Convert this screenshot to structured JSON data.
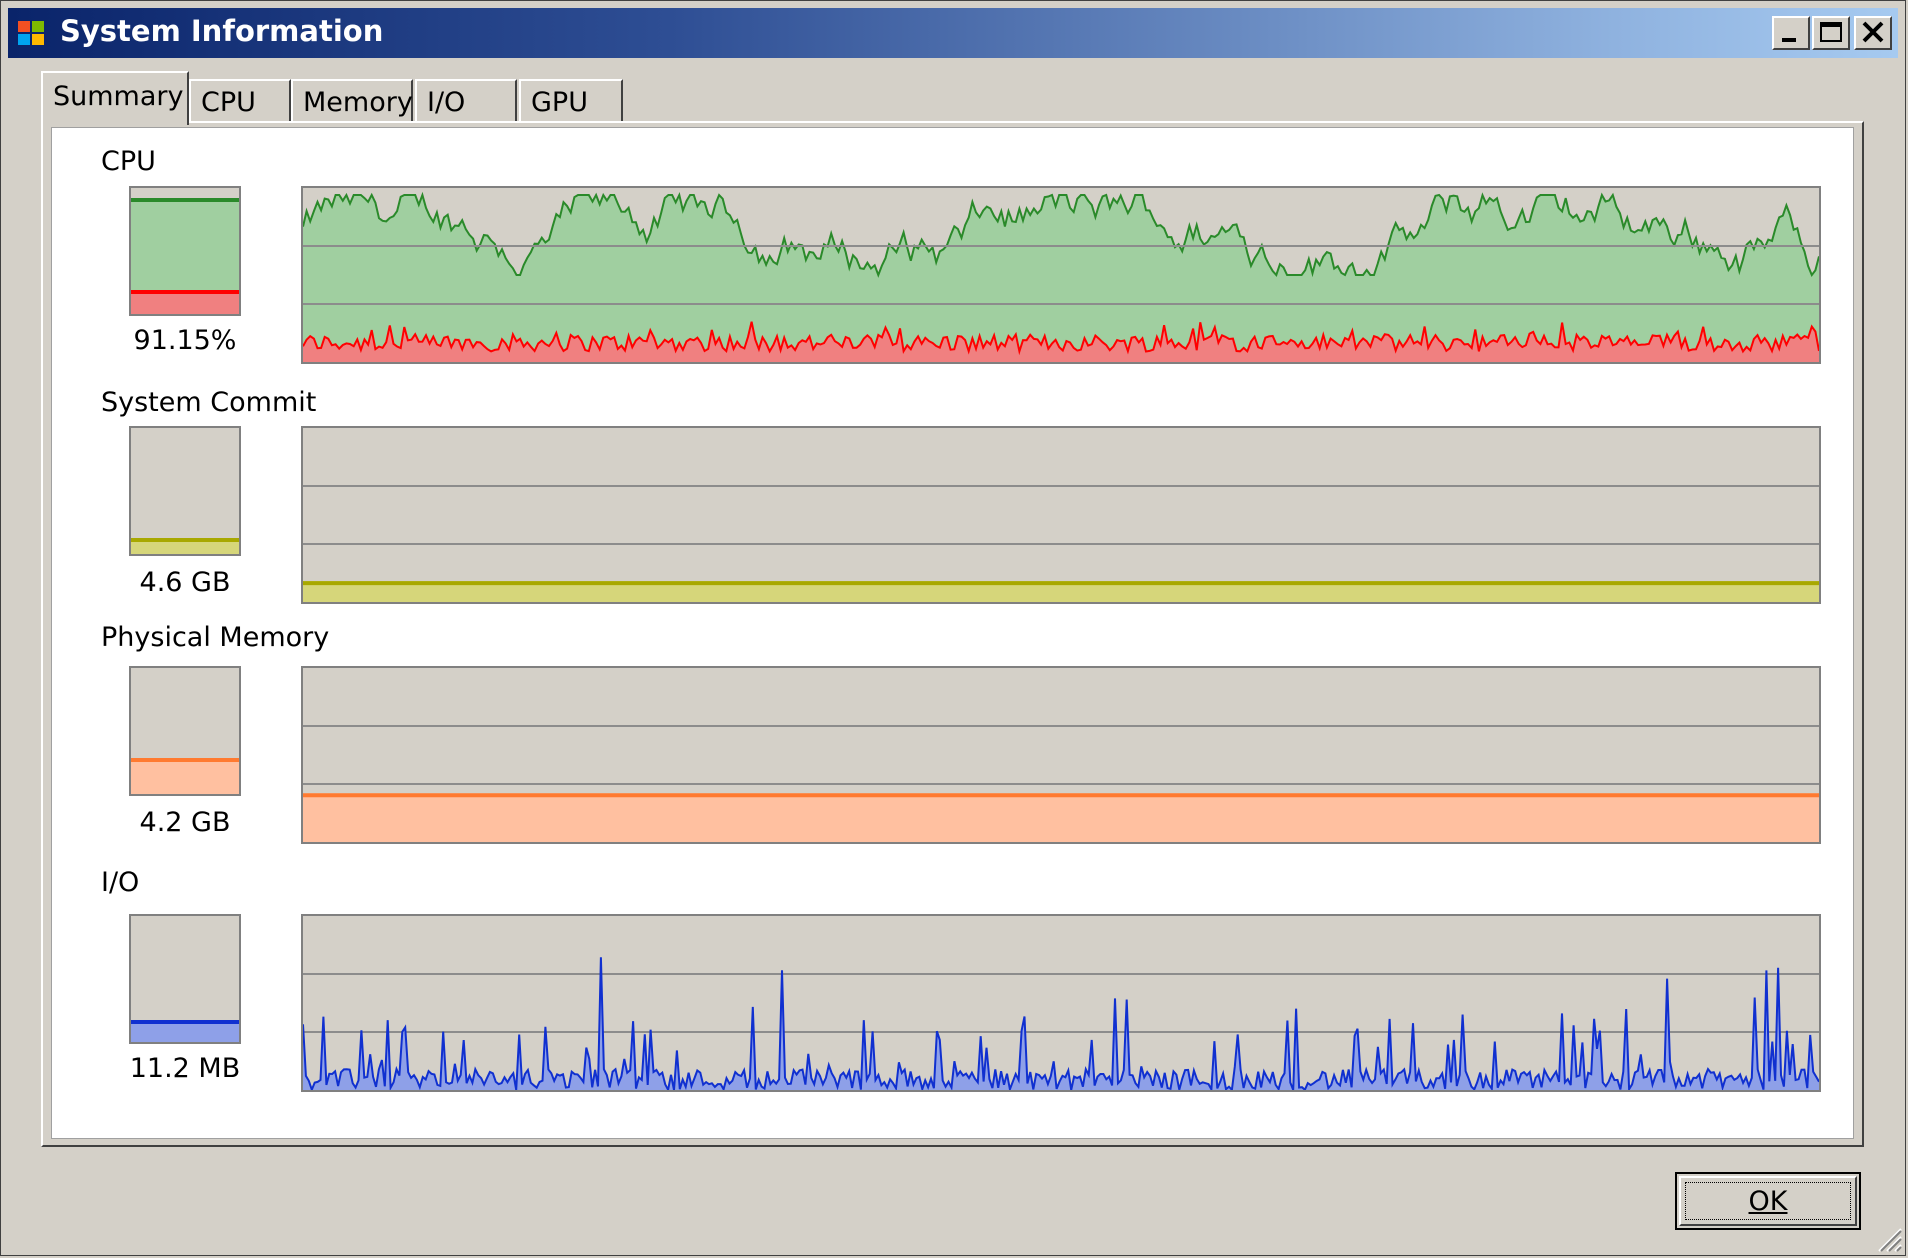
{
  "window": {
    "title": "System Information"
  },
  "tabs": [
    {
      "label": "Summary",
      "active": true
    },
    {
      "label": "CPU",
      "active": false
    },
    {
      "label": "Memory",
      "active": false
    },
    {
      "label": "I/O",
      "active": false
    },
    {
      "label": "GPU",
      "active": false
    }
  ],
  "sections": {
    "cpu": {
      "title": "CPU",
      "value": "91.15%",
      "total_fraction": 0.9115,
      "kernel_fraction": 0.18
    },
    "commit": {
      "title": "System Commit",
      "value": "4.6 GB",
      "fraction": 0.12
    },
    "physical": {
      "title": "Physical Memory",
      "value": "4.2 GB",
      "fraction": 0.28
    },
    "io": {
      "title": "I/O",
      "value": "11.2  MB",
      "fraction": 0.17
    }
  },
  "colors": {
    "cpu_line": "#2a8a2a",
    "cpu_fill": "#a0cfa0",
    "kernel_line": "#ff0000",
    "kernel_fill": "#f08080",
    "commit_line": "#a8a800",
    "commit_fill": "#d6d67a",
    "physical_line": "#ff7a30",
    "physical_fill": "#ffc0a0",
    "io_line": "#1030d0",
    "io_fill": "#8ea0e8"
  },
  "buttons": {
    "ok_label": "OK"
  }
}
